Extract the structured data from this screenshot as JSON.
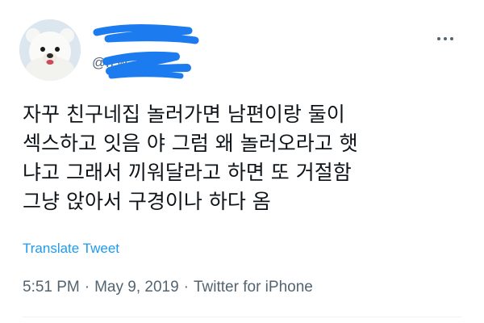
{
  "tweet": {
    "handle": "@n          w",
    "text_lines": [
      "자꾸 친구네집 놀러가면 남편이랑 둘이",
      "섹스하고 잇음 야 그럼 왜 놀러오라고 햇",
      "냐고 그래서 끼워달라고 하면 또 거절함",
      "그냥 앉아서 구경이나 하다 옴"
    ],
    "translate_label": "Translate Tweet",
    "time": "5:51 PM",
    "date": "May 9, 2019",
    "source": "Twitter for iPhone",
    "separator": "·"
  },
  "icons": {
    "more": "more-options-icon",
    "avatar": "white-bear-avatar"
  },
  "colors": {
    "redaction": "#1d7bf0",
    "secondary_text": "#536471",
    "link": "#1d9bf0",
    "primary_text": "#0f1419"
  }
}
